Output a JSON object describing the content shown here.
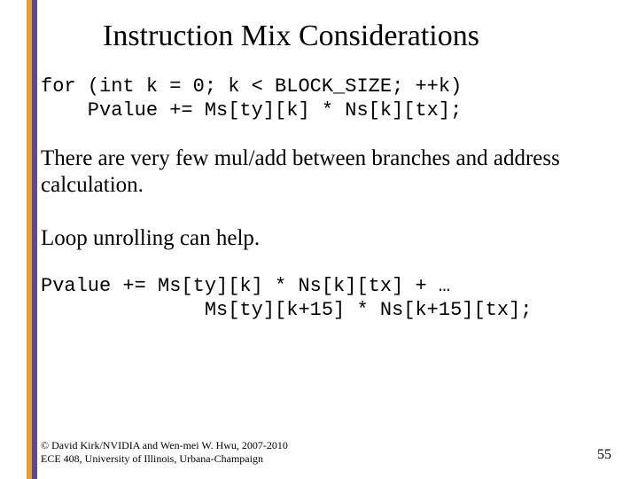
{
  "title": "Instruction Mix Considerations",
  "code1_line1": "for (int k = 0; k < BLOCK_SIZE; ++k)",
  "code1_line2": "    Pvalue += Ms[ty][k] * Ns[k][tx];",
  "body1": "There are very few mul/add between branches and address calculation.",
  "body2": "Loop unrolling can help.",
  "code2_line1": "Pvalue += Ms[ty][k] * Ns[k][tx] + …",
  "code2_line2": "              Ms[ty][k+15] * Ns[k+15][tx];",
  "footer_line1": "© David Kirk/NVIDIA and Wen-mei W. Hwu, 2007-2010",
  "footer_line2": "ECE 408, University of Illinois, Urbana-Champaign",
  "page_number": "55"
}
